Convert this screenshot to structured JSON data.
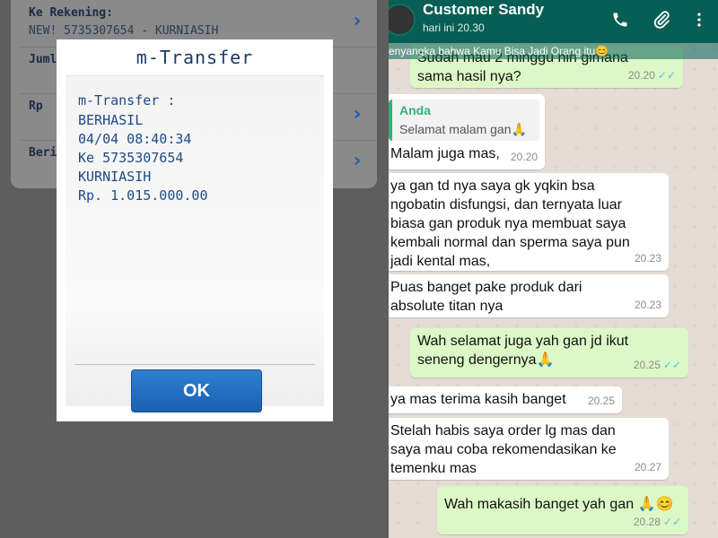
{
  "bank": {
    "fields": [
      {
        "label": "Ke Rekening:",
        "value": "NEW! 5735307654 - KURNIASIH"
      },
      {
        "label": "Jumlah",
        "value": ""
      },
      {
        "label": "Rp",
        "value": ""
      },
      {
        "label": "Berita",
        "value": ""
      }
    ],
    "dialog": {
      "title": "m-Transfer",
      "lines": [
        "m-Transfer :",
        "BERHASIL",
        "04/04 08:40:34",
        "Ke 5735307654",
        "KURNIASIH",
        "Rp. 1.015.000.00"
      ],
      "ok_label": "OK"
    }
  },
  "chat": {
    "header": {
      "contact_name": "Customer Sandy",
      "last_seen": "hari ini 20.30",
      "icons": [
        "phone-icon",
        "attach-icon",
        "more-vert-icon"
      ]
    },
    "ticker": "enyangka bahwa Kamu Bisa Jadi Orang itu😊",
    "messages": [
      {
        "dir": "out",
        "text": "Sudah mau 2 minggu nih gimana\nsama hasil nya?",
        "time": "20.20",
        "read": true
      },
      {
        "dir": "in",
        "quote_author": "Anda",
        "quote_text": "Selamat malam gan🙏",
        "text": "Malam juga mas,",
        "time": "20.20"
      },
      {
        "dir": "in",
        "text": "ya gan td nya saya gk yqkin bsa\nngobatin disfungsi, dan ternyata luar\nbiasa gan produk nya membuat saya\nkembali normal dan sperma saya pun\njadi kental mas,",
        "time": "20.23"
      },
      {
        "dir": "in",
        "text": "Puas banget pake produk dari\nabsolute titan nya",
        "time": "20.23"
      },
      {
        "dir": "out",
        "text": "Wah selamat juga yah gan jd ikut\nseneng dengernya🙏",
        "time": "20.25",
        "read": true
      },
      {
        "dir": "in",
        "text": "ya mas terima kasih banget",
        "time": "20.25"
      },
      {
        "dir": "in",
        "text": "Stelah habis saya order lg mas dan\nsaya mau coba rekomendasikan ke\ntemenku mas",
        "time": "20.27"
      },
      {
        "dir": "out",
        "text": "Wah makasih banget yah gan 🙏😊",
        "time": "20.28",
        "read": true
      }
    ]
  },
  "colors": {
    "header_green": "#075e54",
    "outgoing_bubble": "#dcf8c6",
    "incoming_bubble": "#ffffff",
    "chat_background": "#e5ddd5",
    "read_tick": "#4fc3f7",
    "ok_button": "#1b5fb0"
  }
}
